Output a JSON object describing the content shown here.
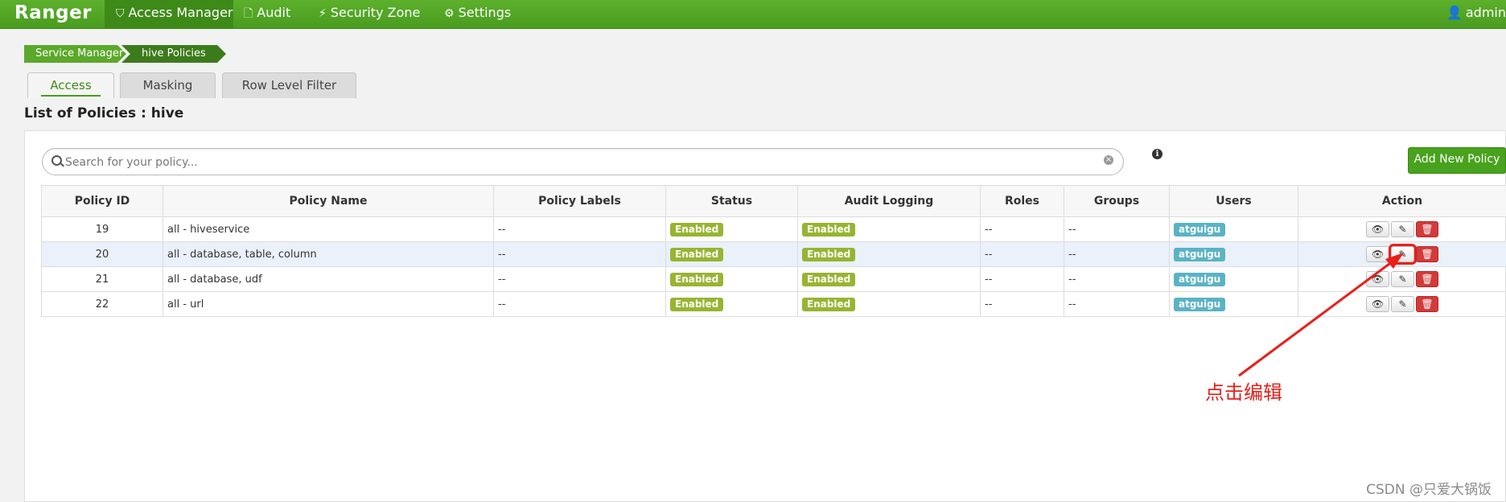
{
  "navbar": {
    "brand": "Ranger",
    "items": [
      {
        "label": "Access Manager",
        "icon": "shield-icon",
        "active": true
      },
      {
        "label": "Audit",
        "icon": "file-icon",
        "active": false
      },
      {
        "label": "Security Zone",
        "icon": "lightning-icon",
        "active": false
      },
      {
        "label": "Settings",
        "icon": "gear-icon",
        "active": false
      }
    ],
    "user": "admin"
  },
  "breadcrumb": [
    "Service Manager",
    "hive Policies"
  ],
  "tabs": [
    {
      "label": "Access",
      "active": true
    },
    {
      "label": "Masking",
      "active": false
    },
    {
      "label": "Row Level Filter",
      "active": false
    }
  ],
  "list_title": "List of Policies : hive",
  "search": {
    "placeholder": "Search for your policy..."
  },
  "add_button": "Add New Policy",
  "table": {
    "headers": [
      "Policy ID",
      "Policy Name",
      "Policy Labels",
      "Status",
      "Audit Logging",
      "Roles",
      "Groups",
      "Users",
      "Action"
    ],
    "rows": [
      {
        "id": "19",
        "name": "all - hiveservice",
        "labels": "--",
        "status": "Enabled",
        "audit": "Enabled",
        "roles": "--",
        "groups": "--",
        "users": "atguigu"
      },
      {
        "id": "20",
        "name": "all - database, table, column",
        "labels": "--",
        "status": "Enabled",
        "audit": "Enabled",
        "roles": "--",
        "groups": "--",
        "users": "atguigu"
      },
      {
        "id": "21",
        "name": "all - database, udf",
        "labels": "--",
        "status": "Enabled",
        "audit": "Enabled",
        "roles": "--",
        "groups": "--",
        "users": "atguigu"
      },
      {
        "id": "22",
        "name": "all - url",
        "labels": "--",
        "status": "Enabled",
        "audit": "Enabled",
        "roles": "--",
        "groups": "--",
        "users": "atguigu"
      }
    ]
  },
  "annotation": "点击编辑",
  "watermark": "CSDN @只爱大锅饭",
  "colors": {
    "brand_green": "#4a9c1f",
    "annotation_red": "#e5201a",
    "badge_green": "#96b531",
    "badge_teal": "#5ab3c5"
  }
}
